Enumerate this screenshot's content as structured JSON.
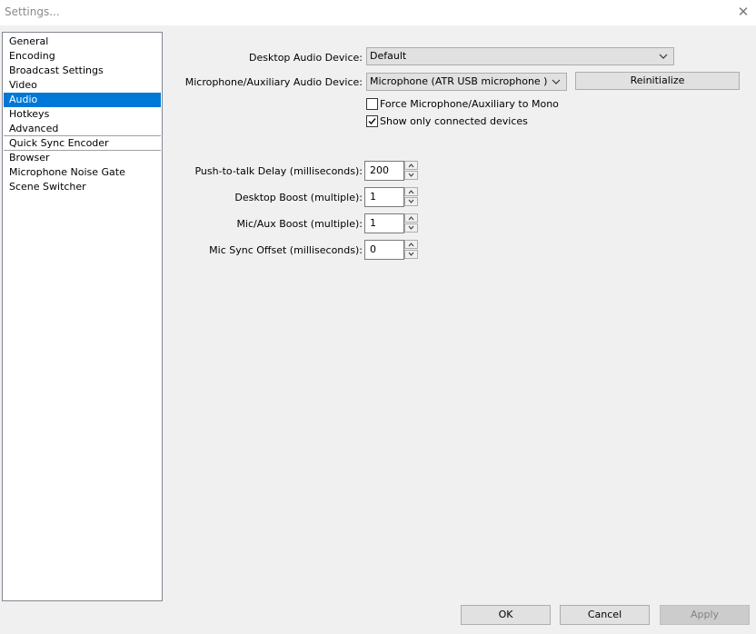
{
  "window": {
    "title": "Settings...",
    "close_icon": "close-icon"
  },
  "sidebar": {
    "items": [
      {
        "label": "General",
        "selected": false
      },
      {
        "label": "Encoding",
        "selected": false
      },
      {
        "label": "Broadcast Settings",
        "selected": false
      },
      {
        "label": "Video",
        "selected": false
      },
      {
        "label": "Audio",
        "selected": true
      },
      {
        "label": "Hotkeys",
        "selected": false
      },
      {
        "label": "Advanced",
        "selected": false
      },
      {
        "label": "Quick Sync Encoder",
        "selected": false
      },
      {
        "label": "Browser",
        "selected": false
      },
      {
        "label": "Microphone Noise Gate",
        "selected": false
      },
      {
        "label": "Scene Switcher",
        "selected": false
      }
    ],
    "selected_color": "#0078d7"
  },
  "audio": {
    "desktop_device": {
      "label": "Desktop Audio Device:",
      "value": "Default"
    },
    "mic_device": {
      "label": "Microphone/Auxiliary Audio Device:",
      "value": "Microphone (ATR USB microphone )"
    },
    "reinitialize_label": "Reinitialize",
    "force_mono": {
      "label": "Force Microphone/Auxiliary to Mono",
      "checked": false
    },
    "show_connected": {
      "label": "Show only connected devices",
      "checked": true
    },
    "push_to_talk": {
      "label": "Push-to-talk Delay (milliseconds):",
      "value": "200"
    },
    "desktop_boost": {
      "label": "Desktop Boost (multiple):",
      "value": "1"
    },
    "mic_boost": {
      "label": "Mic/Aux Boost (multiple):",
      "value": "1"
    },
    "mic_sync": {
      "label": "Mic Sync Offset (milliseconds):",
      "value": "0"
    }
  },
  "footer": {
    "ok_label": "OK",
    "cancel_label": "Cancel",
    "apply_label": "Apply",
    "apply_enabled": false
  }
}
